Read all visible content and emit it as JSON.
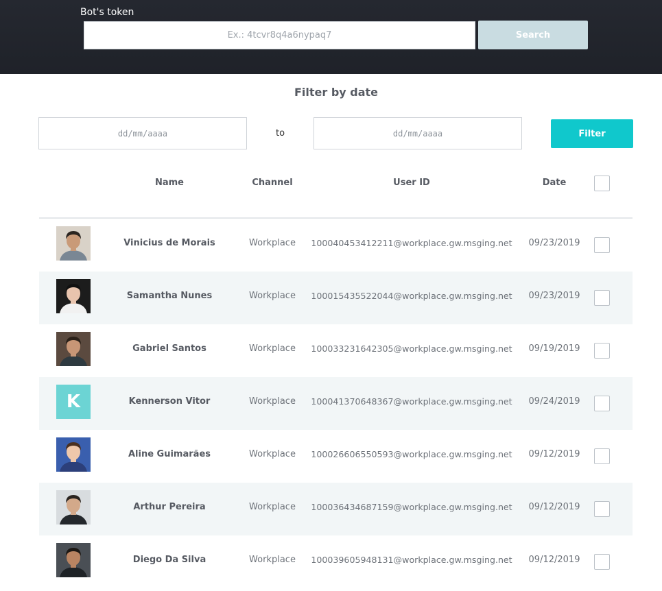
{
  "header": {
    "token_label": "Bot's token",
    "token_placeholder": "Ex.: 4tcvr8q4a6nypaq7",
    "search_label": "Search"
  },
  "filter": {
    "title": "Filter by date",
    "from_placeholder": "dd/mm/aaaa",
    "to_label": "to",
    "to_placeholder": "dd/mm/aaaa",
    "button_label": "Filter"
  },
  "table": {
    "columns": {
      "name": "Name",
      "channel": "Channel",
      "user_id": "User ID",
      "date": "Date"
    },
    "rows": [
      {
        "name": "Vinicius de Morais",
        "channel": "Workplace",
        "user_id": "100040453412211@workplace.gw.msging.net",
        "date": "09/23/2019",
        "avatar": "photo",
        "avatar_bg": "#d9d2c8",
        "avatar_skin": "#c99a78",
        "avatar_hair": "#2b2520",
        "avatar_shirt": "#7a8794"
      },
      {
        "name": "Samantha Nunes",
        "channel": "Workplace",
        "user_id": "100015435522044@workplace.gw.msging.net",
        "date": "09/23/2019",
        "avatar": "photo",
        "avatar_bg": "#1c1c1c",
        "avatar_skin": "#e8c4ae",
        "avatar_hair": "#111111",
        "avatar_shirt": "#f1f1f1"
      },
      {
        "name": "Gabriel Santos",
        "channel": "Workplace",
        "user_id": "100033231642305@workplace.gw.msging.net",
        "date": "09/19/2019",
        "avatar": "photo",
        "avatar_bg": "#5b4a3f",
        "avatar_skin": "#c89676",
        "avatar_hair": "#2a2018",
        "avatar_shirt": "#2e3a40"
      },
      {
        "name": "Kennerson Vitor",
        "channel": "Workplace",
        "user_id": "100041370648367@workplace.gw.msging.net",
        "date": "09/24/2019",
        "avatar": "letter",
        "avatar_letter": "K"
      },
      {
        "name": "Aline Guimarães",
        "channel": "Workplace",
        "user_id": "100026606550593@workplace.gw.msging.net",
        "date": "09/12/2019",
        "avatar": "photo",
        "avatar_bg": "#3a5fae",
        "avatar_skin": "#efc8ab",
        "avatar_hair": "#4a3020",
        "avatar_shirt": "#2c3f7a"
      },
      {
        "name": "Arthur Pereira",
        "channel": "Workplace",
        "user_id": "100036434687159@workplace.gw.msging.net",
        "date": "09/12/2019",
        "avatar": "photo",
        "avatar_bg": "#d8dcdf",
        "avatar_skin": "#d3a98a",
        "avatar_hair": "#2a2420",
        "avatar_shirt": "#24282c"
      },
      {
        "name": "Diego Da Silva",
        "channel": "Workplace",
        "user_id": "100039605948131@workplace.gw.msging.net",
        "date": "09/12/2019",
        "avatar": "photo",
        "avatar_bg": "#4a4f55",
        "avatar_skin": "#b98462",
        "avatar_hair": "#1c1814",
        "avatar_shirt": "#1e2226"
      }
    ]
  }
}
